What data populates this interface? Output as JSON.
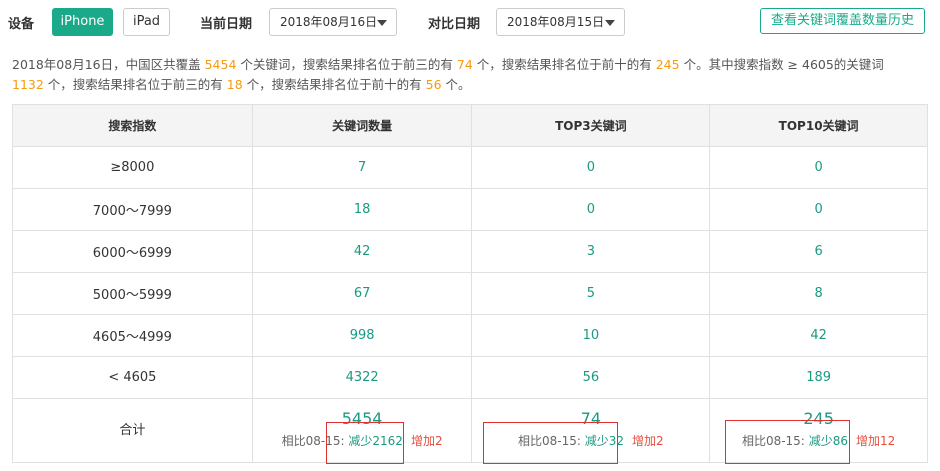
{
  "toolbar": {
    "device_label": "设备",
    "device_options": [
      "iPhone",
      "iPad"
    ],
    "current_date_label": "当前日期",
    "current_date_value": "2018年08月16日",
    "compare_date_label": "对比日期",
    "compare_date_value": "2018年08月15日",
    "history_button": "查看关键词覆盖数量历史"
  },
  "summary": {
    "p1": "2018年08月16日，中国区共覆盖 ",
    "v1": "5454",
    "p2": " 个关键词，搜索结果排名位于前三的有 ",
    "v2": "74",
    "p3": " 个，搜索结果排名位于前十的有 ",
    "v3": "245",
    "p4": " 个。其中搜索指数 ≥ 4605的关键词 ",
    "v4": "1132",
    "p5": " 个，搜索结果排名位于前三的有 ",
    "v5": "18",
    "p6": " 个，搜索结果排名位于前十的有 ",
    "v6": "56",
    "p7": " 个。"
  },
  "table": {
    "headers": [
      "搜索指数",
      "关键词数量",
      "TOP3关键词",
      "TOP10关键词"
    ],
    "rows": [
      [
        "≥8000",
        "7",
        "0",
        "0"
      ],
      [
        "7000～7999",
        "18",
        "0",
        "0"
      ],
      [
        "6000～6999",
        "42",
        "3",
        "6"
      ],
      [
        "5000～5999",
        "67",
        "5",
        "8"
      ],
      [
        "4605～4999",
        "998",
        "10",
        "42"
      ],
      [
        "< 4605",
        "4322",
        "56",
        "189"
      ]
    ],
    "total": {
      "label": "合计",
      "cols": [
        {
          "value": "5454",
          "cmp_prefix": "相比08-15:",
          "dec": "减少2162",
          "inc": "增加2"
        },
        {
          "value": "74",
          "cmp_prefix": "相比08-15:",
          "dec": "减少32",
          "inc": "增加2"
        },
        {
          "value": "245",
          "cmp_prefix": "相比08-15:",
          "dec": "减少86",
          "inc": "增加12"
        }
      ]
    }
  }
}
